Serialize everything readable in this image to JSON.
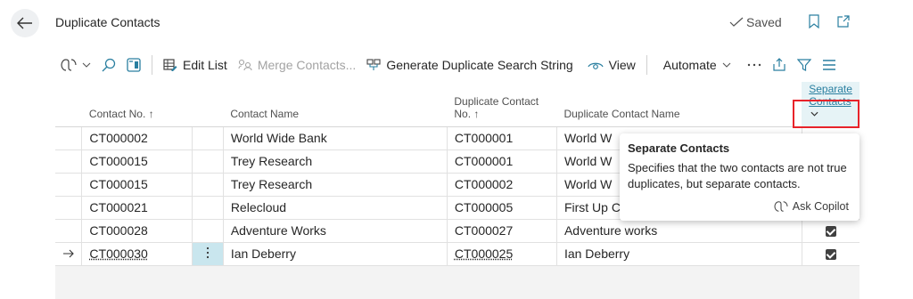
{
  "header": {
    "title": "Duplicate Contacts",
    "saved_label": "Saved"
  },
  "toolbar": {
    "edit_list": "Edit List",
    "merge_contacts": "Merge Contacts...",
    "generate_search": "Generate Duplicate Search String",
    "view": "View",
    "automate": "Automate"
  },
  "table": {
    "headers": {
      "contact_no": "Contact No. ↑",
      "contact_name": "Contact Name",
      "dup_no_line1": "Duplicate Contact",
      "dup_no_line2": "No. ↑",
      "dup_name": "Duplicate Contact Name",
      "separate_line1": "Separate",
      "separate_line2": "Contacts"
    },
    "rows": [
      {
        "contact_no": "CT000002",
        "contact_name": "World Wide Bank",
        "dup_no": "CT000001",
        "dup_name": "World W",
        "separate": true,
        "current": false
      },
      {
        "contact_no": "CT000015",
        "contact_name": "Trey Research",
        "dup_no": "CT000001",
        "dup_name": "World W",
        "separate": true,
        "current": false
      },
      {
        "contact_no": "CT000015",
        "contact_name": "Trey Research",
        "dup_no": "CT000002",
        "dup_name": "World W",
        "separate": true,
        "current": false
      },
      {
        "contact_no": "CT000021",
        "contact_name": "Relecloud",
        "dup_no": "CT000005",
        "dup_name": "First Up C",
        "separate": true,
        "current": false
      },
      {
        "contact_no": "CT000028",
        "contact_name": "Adventure Works",
        "dup_no": "CT000027",
        "dup_name": "Adventure works",
        "separate": true,
        "current": false
      },
      {
        "contact_no": "CT000030",
        "contact_name": "Ian Deberry",
        "dup_no": "CT000025",
        "dup_name": "Ian Deberry",
        "separate": true,
        "current": true
      }
    ]
  },
  "tooltip": {
    "title": "Separate Contacts",
    "text": "Specifies that the two contacts are not true duplicates, but separate contacts.",
    "ask_copilot": "Ask Copilot"
  },
  "colors": {
    "highlight": "#e8232a",
    "accent": "#2a7fa0",
    "selected_cell": "#c9e6ee"
  }
}
